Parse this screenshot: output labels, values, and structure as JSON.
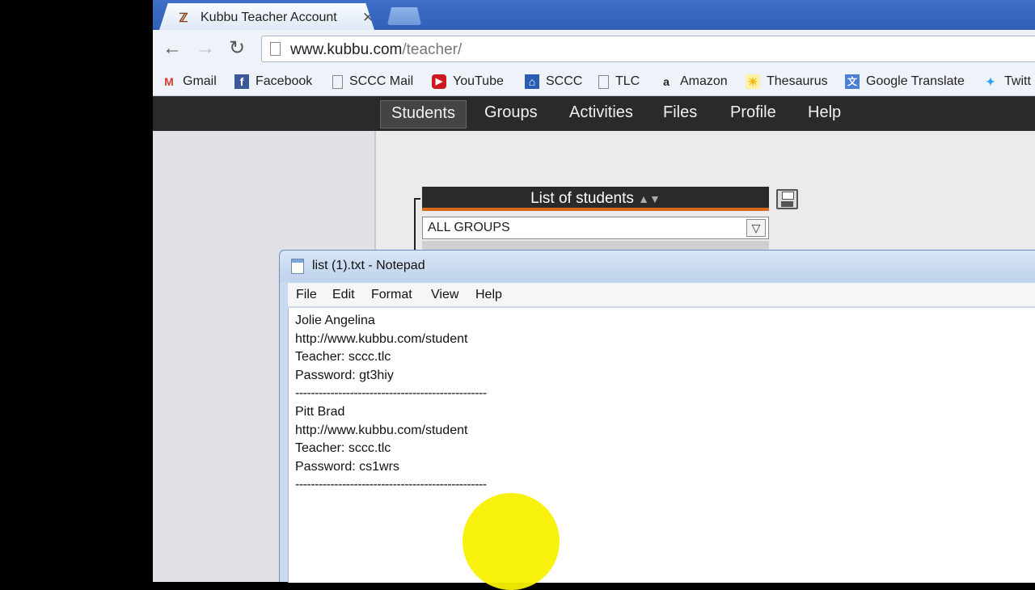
{
  "browser": {
    "tab": {
      "title": "Kubbu Teacher Account",
      "close": "✕",
      "favicon": "ℤ"
    },
    "toolbar": {
      "back": "←",
      "forward": "→",
      "reload": "↻"
    },
    "url": {
      "host": "www.kubbu.com",
      "path": "/teacher/"
    },
    "bookmarks": [
      {
        "label": "Gmail",
        "icon": "M",
        "color": "#d23f31"
      },
      {
        "label": "Facebook",
        "icon": "f",
        "color": "#3b5998"
      },
      {
        "label": "SCCC Mail",
        "icon": "",
        "color": "#888888"
      },
      {
        "label": "YouTube",
        "icon": "▶",
        "color": "#cc181e"
      },
      {
        "label": "SCCC",
        "icon": "⌂",
        "color": "#2a5db0"
      },
      {
        "label": "TLC",
        "icon": "",
        "color": "#888888"
      },
      {
        "label": "Amazon",
        "icon": "a",
        "color": "#222222"
      },
      {
        "label": "Thesaurus",
        "icon": "☀",
        "color": "#f0b400"
      },
      {
        "label": "Google Translate",
        "icon": "文",
        "color": "#4a7fd8"
      },
      {
        "label": "Twitt",
        "icon": "✦",
        "color": "#2aa3ef"
      }
    ]
  },
  "site_nav": {
    "items": [
      "Students",
      "Groups",
      "Activities",
      "Files",
      "Profile",
      "Help"
    ],
    "active": "Students"
  },
  "students_panel": {
    "title": "List of students",
    "sort_arrows": "▲▼",
    "group_filter": "ALL GROUPS",
    "select_arrow": "▽"
  },
  "notepad": {
    "title": "list (1).txt - Notepad",
    "menu": [
      "File",
      "Edit",
      "Format",
      "View",
      "Help"
    ],
    "lines": [
      "Jolie Angelina",
      "http://www.kubbu.com/student",
      "Teacher: sccc.tlc",
      "Password: gt3hiy",
      "-------------------------------------------------",
      "Pitt Brad",
      "http://www.kubbu.com/student",
      "Teacher: sccc.tlc",
      "Password: cs1wrs",
      "-------------------------------------------------"
    ]
  },
  "colors": {
    "nav_bar": "#2a2a2a",
    "accent_orange": "#d7691c",
    "tabstrip_blue": "#2f5fb8",
    "cursor_highlight": "#f7f000"
  }
}
